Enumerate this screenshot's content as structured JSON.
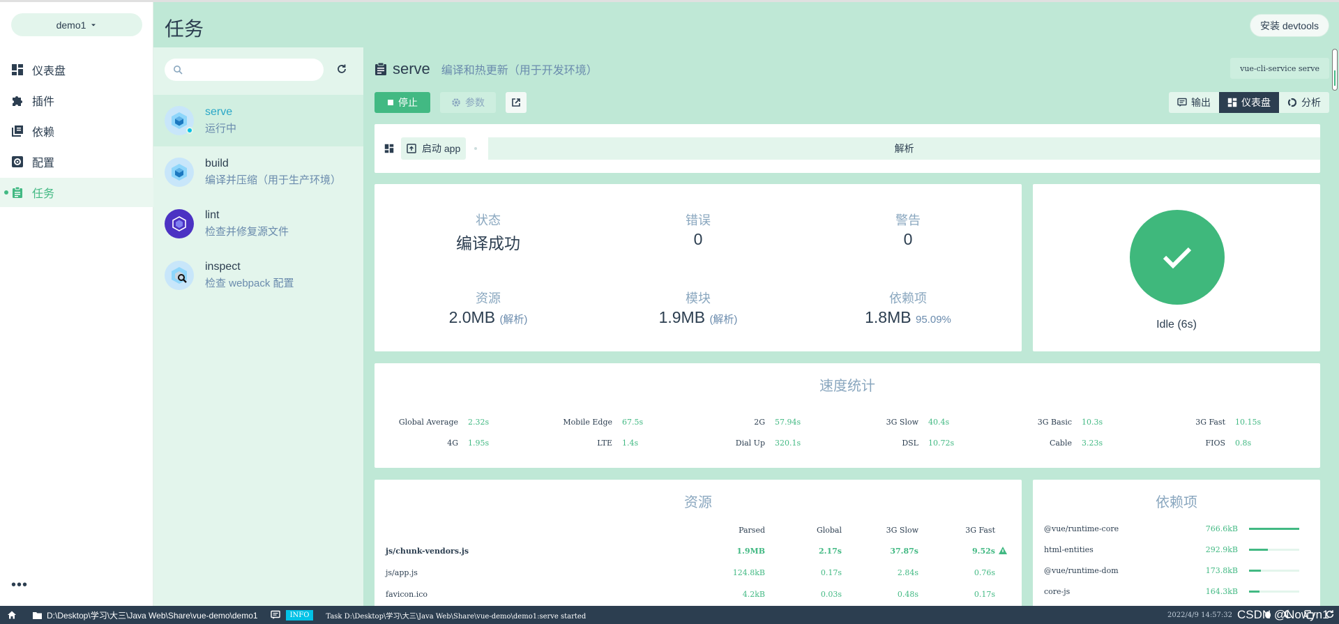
{
  "project": {
    "name": "demo1"
  },
  "nav": [
    {
      "id": "dashboard",
      "label": "仪表盘",
      "icon": "dashboard-icon"
    },
    {
      "id": "plugins",
      "label": "插件",
      "icon": "puzzle-icon"
    },
    {
      "id": "dependencies",
      "label": "依赖",
      "icon": "library-books-icon"
    },
    {
      "id": "config",
      "label": "配置",
      "icon": "settings-applications-icon"
    },
    {
      "id": "tasks",
      "label": "任务",
      "icon": "assignment-icon",
      "active": true
    }
  ],
  "more_label": "•••",
  "header": {
    "title": "任务",
    "devtools_label": "安装 devtools"
  },
  "tasks": [
    {
      "name": "serve",
      "desc": "运行中",
      "selected": true,
      "running": true
    },
    {
      "name": "build",
      "desc": "编译并压缩（用于生产环境）"
    },
    {
      "name": "lint",
      "desc": "检查并修复源文件"
    },
    {
      "name": "inspect",
      "desc": "检查 webpack 配置"
    }
  ],
  "search": {
    "placeholder": ""
  },
  "detail": {
    "name": "serve",
    "description": "编译和热更新（用于开发环境）",
    "command": "vue-cli-service serve",
    "stop_label": "停止",
    "params_label": "参数",
    "views": {
      "output": "输出",
      "dashboard": "仪表盘",
      "analyzer": "分析"
    },
    "start_app_label": "启动 app",
    "phase_label": "解析"
  },
  "stats": {
    "status": {
      "label": "状态",
      "value": "编译成功"
    },
    "errors": {
      "label": "错误",
      "value": "0"
    },
    "warnings": {
      "label": "警告",
      "value": "0"
    },
    "assets": {
      "label": "资源",
      "value": "2.0MB",
      "note": "(解析)"
    },
    "modules": {
      "label": "模块",
      "value": "1.9MB",
      "note": "(解析)"
    },
    "deps": {
      "label": "依赖项",
      "value": "1.8MB",
      "note": "95.09%"
    }
  },
  "build_status": {
    "label": "Idle (6s)",
    "color": "#3fb87c"
  },
  "speed": {
    "title": "速度统计",
    "items": [
      {
        "k": "Global Average",
        "v": "2.32s"
      },
      {
        "k": "Mobile Edge",
        "v": "67.5s"
      },
      {
        "k": "2G",
        "v": "57.94s"
      },
      {
        "k": "3G Slow",
        "v": "40.4s"
      },
      {
        "k": "3G Basic",
        "v": "10.3s"
      },
      {
        "k": "3G Fast",
        "v": "10.15s"
      },
      {
        "k": "4G",
        "v": "1.95s"
      },
      {
        "k": "LTE",
        "v": "1.4s"
      },
      {
        "k": "Dial Up",
        "v": "320.1s"
      },
      {
        "k": "DSL",
        "v": "10.72s"
      },
      {
        "k": "Cable",
        "v": "3.23s"
      },
      {
        "k": "FIOS",
        "v": "0.8s"
      }
    ]
  },
  "assets": {
    "title": "资源",
    "headers": [
      "Parsed",
      "Global",
      "3G Slow",
      "3G Fast"
    ],
    "rows": [
      {
        "name": "js/chunk-vendors.js",
        "cells": [
          "1.9MB",
          "2.17s",
          "37.87s",
          "9.52s"
        ],
        "big": true,
        "warn": true
      },
      {
        "name": "js/app.js",
        "cells": [
          "124.8kB",
          "0.17s",
          "2.84s",
          "0.76s"
        ]
      },
      {
        "name": "favicon.ico",
        "cells": [
          "4.2kB",
          "0.03s",
          "0.48s",
          "0.17s"
        ]
      }
    ]
  },
  "dependencies": {
    "title": "依赖项",
    "rows": [
      {
        "name": "@vue/runtime-core",
        "size": "766.6kB",
        "ratio": 1.0
      },
      {
        "name": "html-entities",
        "size": "292.9kB",
        "ratio": 0.38
      },
      {
        "name": "@vue/runtime-dom",
        "size": "173.8kB",
        "ratio": 0.23
      },
      {
        "name": "core-js",
        "size": "164.3kB",
        "ratio": 0.21
      }
    ]
  },
  "statusbar": {
    "path": "D:\\Desktop\\学习\\大三\\Java Web\\Share\\vue-demo\\demo1",
    "level": "INFO",
    "message": "Task D:\\Desktop\\学习\\大三\\Java Web\\Share\\vue-demo\\demo1:serve started",
    "time": "2022/4/9 14:57:32",
    "watermark": "CSDN @Nowyn1"
  },
  "colors": {
    "accent": "#42b983",
    "dark": "#2c3e50",
    "panel": "#bfe8d6",
    "light": "#e3f5ec",
    "running": "#03c2e6"
  }
}
